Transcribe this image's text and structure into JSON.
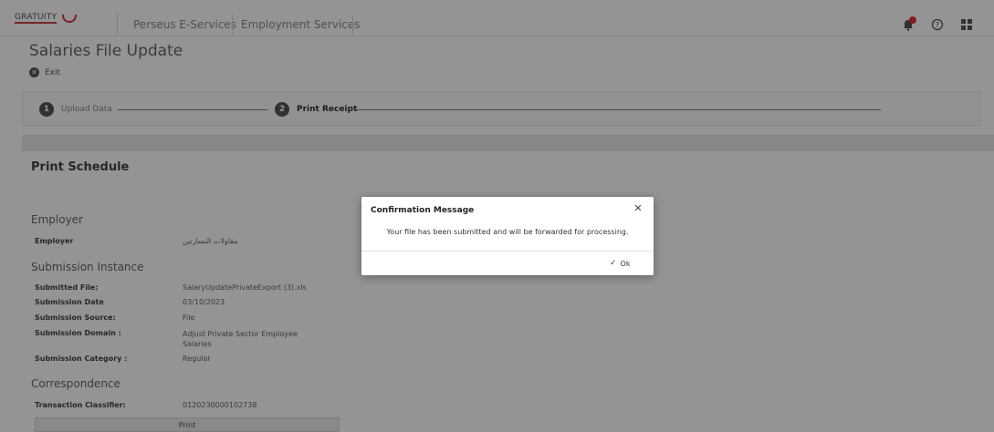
{
  "header": {
    "logo_text": "GRATUITY",
    "nav": [
      "Perseus E-Services",
      "Employment Services"
    ],
    "icons": [
      "notification-bell-icon",
      "help-icon",
      "apps-grid-icon"
    ]
  },
  "page": {
    "title": "Salaries File Update",
    "exit_label": "Exit"
  },
  "steps": [
    {
      "number": "1",
      "label": "Upload Data"
    },
    {
      "number": "2",
      "label": "Print Receipt"
    }
  ],
  "schedule": {
    "title": "Print Schedule",
    "employer_section": "Employer",
    "employer_label": "Employer",
    "employer_value": "مقاولات النسارتين",
    "submission_section": "Submission Instance",
    "fields": [
      {
        "label": "Submitted File:",
        "value": "SalaryUpdatePrivateExport (3).xls"
      },
      {
        "label": "Submission Date",
        "value": "03/10/2023"
      },
      {
        "label": "Submission Source:",
        "value": "File"
      },
      {
        "label": "Submission Domain :",
        "value": "Adjust Private Sector Employee Salaries"
      },
      {
        "label": "Submission Category :",
        "value": "Regular"
      }
    ],
    "correspondence_section": "Correspondence",
    "transaction_label": "Transaction Classifier:",
    "transaction_value": "0120230000102738",
    "print_label": "Print"
  },
  "modal": {
    "title": "Confirmation Message",
    "message": "Your file has been submitted and will be forwarded for processing.",
    "ok_label": "Ok",
    "close_icon": "close-icon"
  },
  "colors": {
    "accent": "#d9343a",
    "overlay": "rgba(0,0,0,0.42)"
  }
}
